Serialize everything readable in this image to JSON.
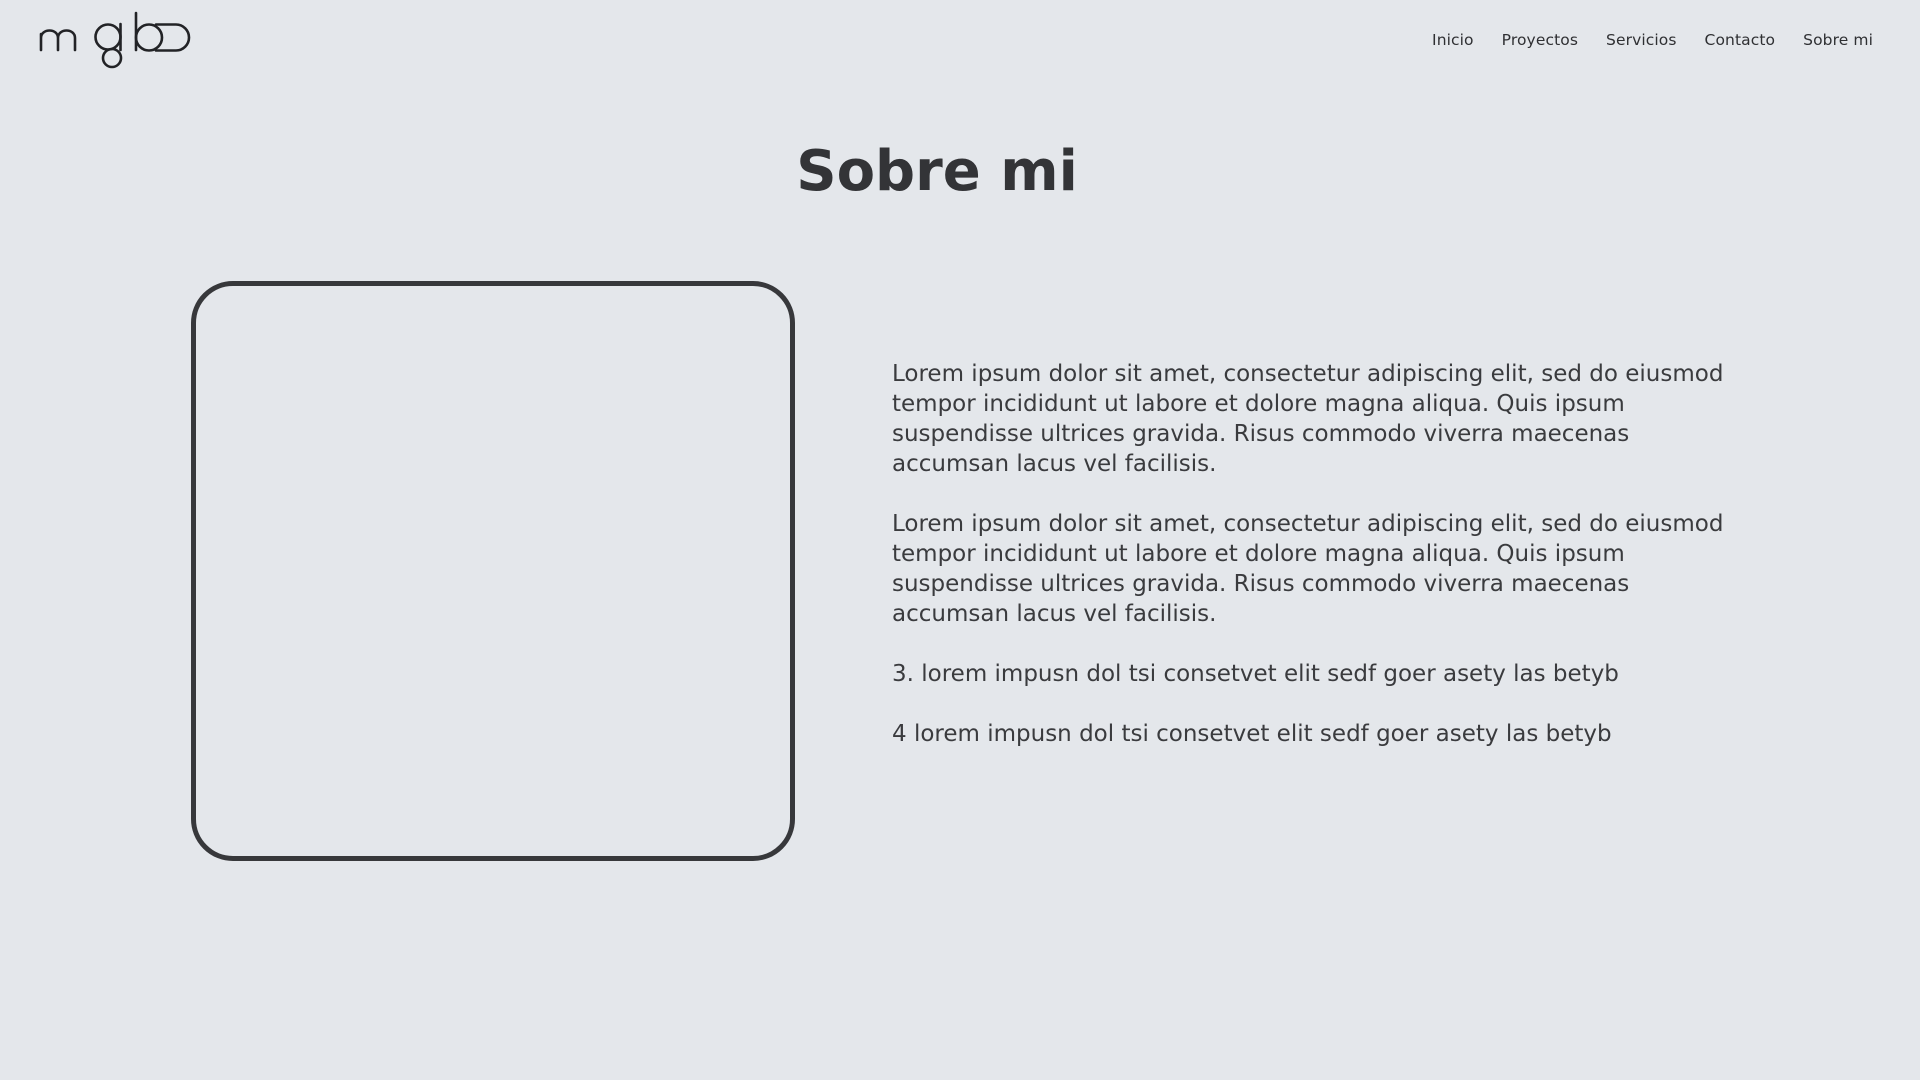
{
  "header": {
    "logo_alt": "mgbo",
    "nav": [
      {
        "label": "Inicio"
      },
      {
        "label": "Proyectos"
      },
      {
        "label": "Servicios"
      },
      {
        "label": "Contacto"
      },
      {
        "label": "Sobre mi"
      }
    ]
  },
  "main": {
    "title": "Sobre mi",
    "paragraphs": [
      "Lorem ipsum dolor sit amet, consectetur adipiscing elit, sed do eiusmod tempor incididunt ut labore et dolore magna aliqua. Quis ipsum suspendisse ultrices gravida. Risus commodo viverra maecenas accumsan lacus vel facilisis.",
      "Lorem ipsum dolor sit amet, consectetur adipiscing elit, sed do eiusmod tempor incididunt ut labore et dolore magna aliqua. Quis ipsum suspendisse ultrices gravida. Risus commodo viverra maecenas accumsan lacus vel facilisis.",
      "3. lorem impusn dol tsi consetvet elit sedf goer asety las betyb",
      "4 lorem impusn dol tsi consetvet elit sedf goer asety las betyb"
    ]
  },
  "colors": {
    "background": "#e4e7eb",
    "text": "#343538",
    "frame_border": "#37383b"
  }
}
